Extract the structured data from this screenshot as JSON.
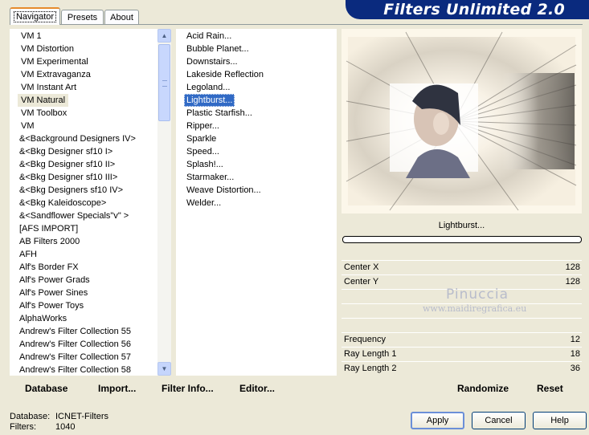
{
  "tabs": [
    "Navigator",
    "Presets",
    "About"
  ],
  "banner_title": "Filters Unlimited 2.0",
  "categories": [
    "VM 1",
    "VM Distortion",
    "VM Experimental",
    "VM Extravaganza",
    "VM Instant Art",
    "VM Natural",
    "VM Toolbox",
    "VM",
    "&<Background Designers IV>",
    "&<Bkg Designer sf10 I>",
    "&<Bkg Designer sf10 II>",
    "&<Bkg Designer sf10 III>",
    "&<Bkg Designers sf10 IV>",
    "&<Bkg Kaleidoscope>",
    "&<Sandflower Specials\"v\" >",
    "[AFS IMPORT]",
    "AB Filters 2000",
    "AFH",
    "Alf's Border FX",
    "Alf's Power Grads",
    "Alf's Power Sines",
    "Alf's Power Toys",
    "AlphaWorks",
    "Andrew's Filter Collection 55",
    "Andrew's Filter Collection 56",
    "Andrew's Filter Collection 57",
    "Andrew's Filter Collection 58"
  ],
  "selected_category": "VM Natural",
  "filters": [
    "Acid Rain...",
    "Bubble Planet...",
    "Downstairs...",
    "Lakeside Reflection",
    "Legoland...",
    "Lightburst...",
    "Plastic Starfish...",
    "Ripper...",
    "Sparkle",
    "Speed...",
    "Splash!...",
    "Starmaker...",
    "Weave Distortion...",
    "Welder..."
  ],
  "selected_filter": "Lightburst...",
  "toolbar": {
    "database": "Database",
    "import": "Import...",
    "filter_info": "Filter Info...",
    "editor": "Editor..."
  },
  "filter_name_label": "Lightburst...",
  "params": [
    {
      "label": "Center X",
      "value": "128"
    },
    {
      "label": "Center Y",
      "value": "128"
    },
    {
      "label": "Frequency",
      "value": "12"
    },
    {
      "label": "Ray Length 1",
      "value": "18"
    },
    {
      "label": "Ray Length 2",
      "value": "36"
    }
  ],
  "randomize_label": "Randomize",
  "reset_label": "Reset",
  "watermark": {
    "name": "Pinuccia",
    "url": "www.maidiregrafica.eu"
  },
  "status": {
    "database_label": "Database:",
    "database_value": "ICNET-Filters",
    "filters_label": "Filters:",
    "filters_value": "1040"
  },
  "buttons": {
    "apply": "Apply",
    "cancel": "Cancel",
    "help": "Help"
  },
  "colors": {
    "banner": "#0a2a7e",
    "selection": "#316ac5",
    "window": "#ece9d8"
  }
}
